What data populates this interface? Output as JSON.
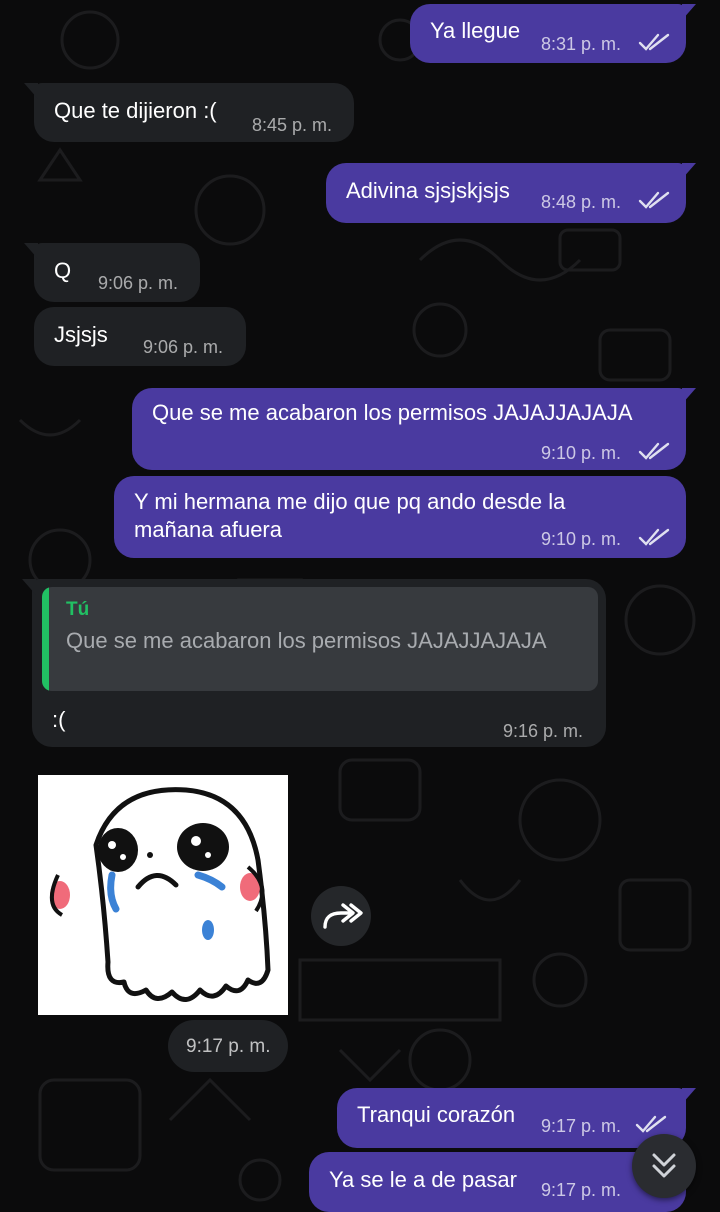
{
  "messages": [
    {
      "text": "Ya llegue",
      "time": "8:31 p. m."
    },
    {
      "text": "Que te dijieron :(",
      "time": "8:45 p. m."
    },
    {
      "text": "Adivina sjsjskjsjs",
      "time": "8:48 p. m."
    },
    {
      "text": "Q",
      "time": "9:06 p. m."
    },
    {
      "text": "Jsjsjs",
      "time": "9:06 p. m."
    },
    {
      "text": "Que se me acabaron los permisos JAJAJJAJAJA",
      "time": "9:10 p. m."
    },
    {
      "text_line1": "Y mi hermana me dijo que pq ando desde la",
      "text_line2": "mañana afuera",
      "time": "9:10 p. m."
    },
    {
      "quote_author": "Tú",
      "quote_text": "Que se me acabaron los permisos JAJAJJAJAJA",
      "text": ":(",
      "time": "9:16 p. m."
    },
    {
      "sticker": "crying-ghost-sticker",
      "time": "9:17 p. m."
    },
    {
      "text": "Tranqui corazón",
      "time": "9:17 p. m."
    },
    {
      "text": "Ya se le a de pasar",
      "time": "9:17 p. m."
    }
  ],
  "icons": {
    "read_receipt": "double-check-icon",
    "forward": "forward-icon",
    "scroll_down": "double-chevron-down-icon"
  },
  "colors": {
    "outgoing_bubble": "#4a3aa0",
    "incoming_bubble": "#1f2124",
    "quote_accent": "#21c063",
    "background": "#0b0b0c"
  }
}
